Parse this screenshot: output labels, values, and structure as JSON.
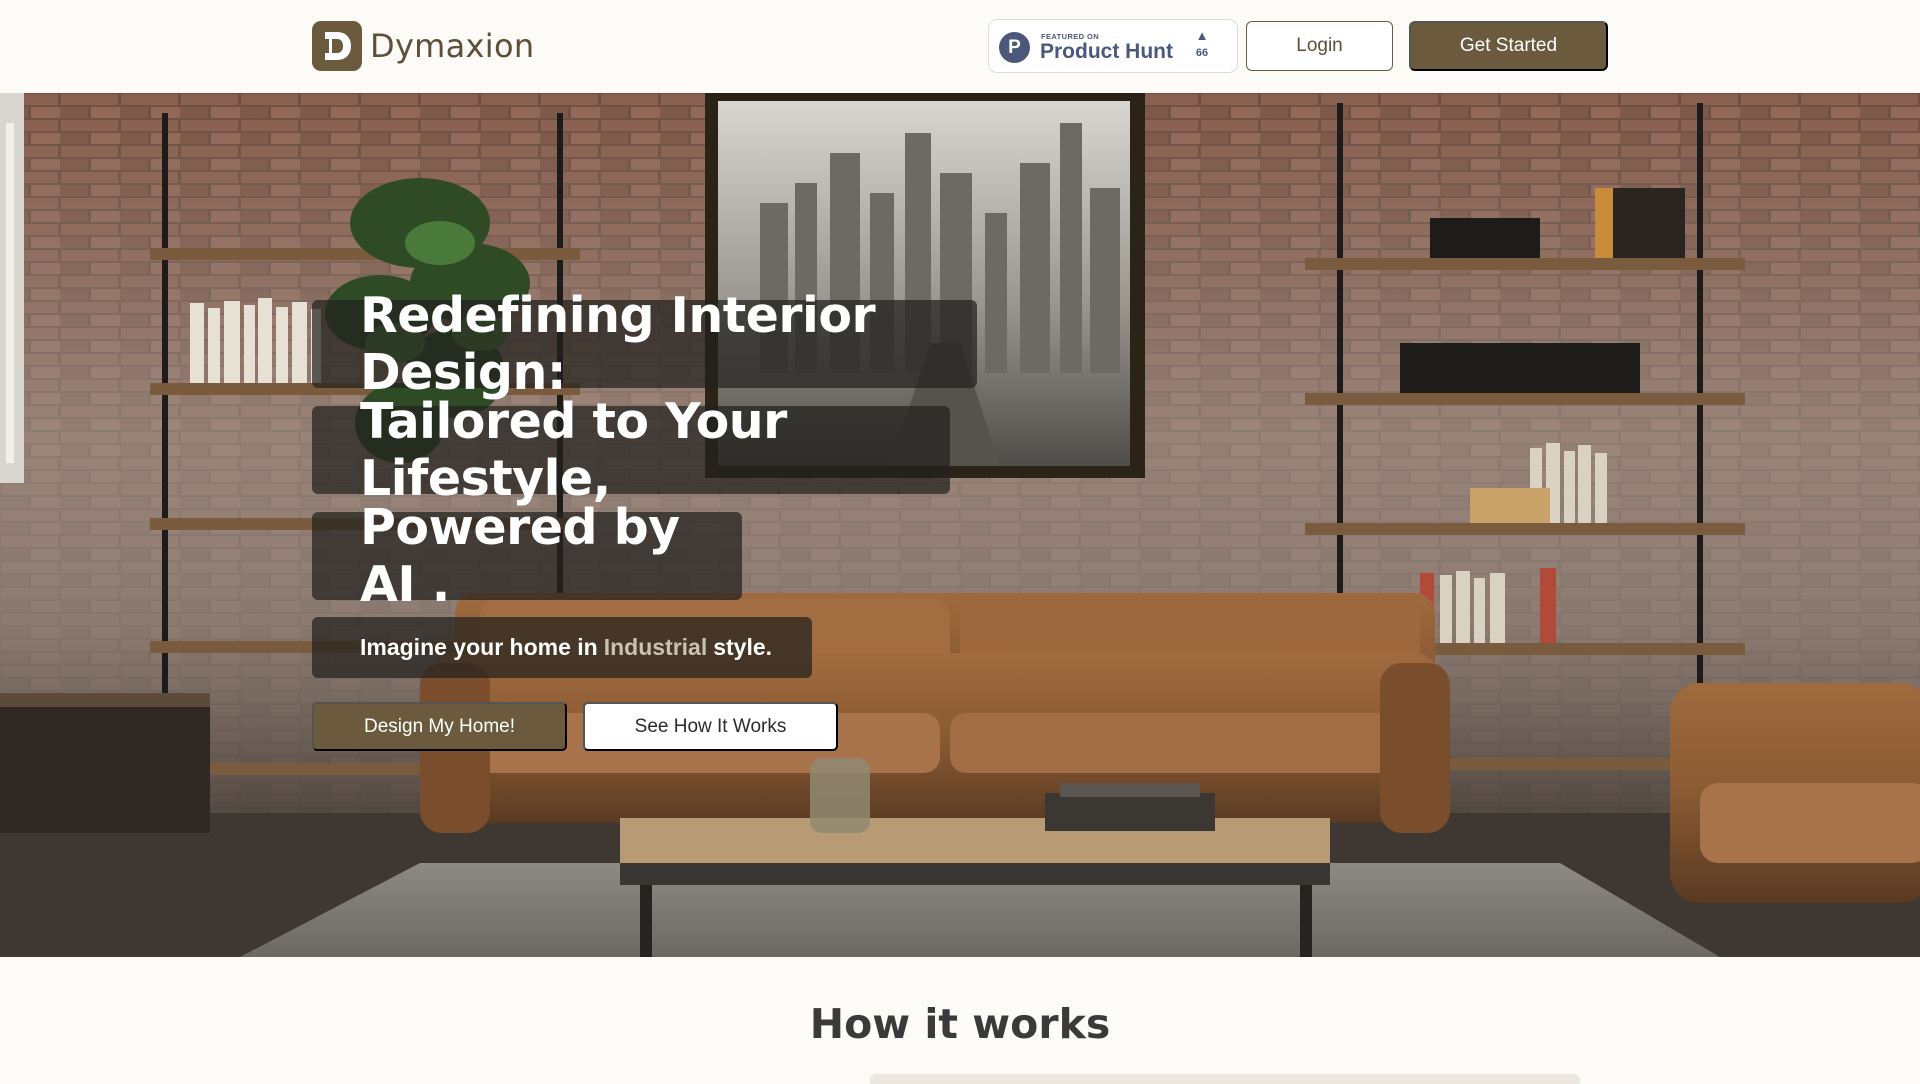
{
  "brand": {
    "logo_letter": "D",
    "name": "Dymaxion"
  },
  "product_hunt": {
    "featured_label": "FEATURED ON",
    "name": "Product Hunt",
    "upvotes": "66",
    "icon_letter": "P"
  },
  "nav": {
    "login_label": "Login",
    "get_started_label": "Get Started"
  },
  "hero": {
    "headline_lines": [
      "Redefining Interior Design:",
      "Tailored to Your Lifestyle,",
      "Powered by AI ."
    ],
    "subtitle_before": "Imagine your home in",
    "subtitle_style": "Industrial",
    "subtitle_after": "style.",
    "primary_button": "Design My Home!",
    "secondary_button": "See How It Works"
  },
  "how_it_works": {
    "title": "How it works"
  },
  "colors": {
    "accent": "#6b5a3e",
    "nav_bg": "#fcfbf8",
    "overlay": "#23211f",
    "product_hunt": "#4b587c"
  },
  "icons": {
    "logo": "dymaxion-logo-icon",
    "product_hunt": "product-hunt-icon",
    "upvote": "upvote-arrow-icon"
  }
}
